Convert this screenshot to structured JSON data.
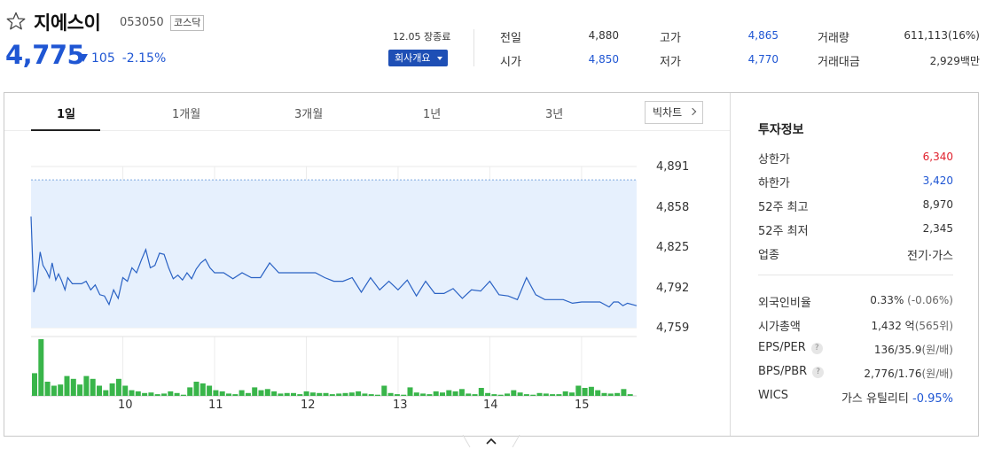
{
  "stock": {
    "name": "지에스이",
    "code": "053050",
    "market": "코스닥",
    "price": "4,775",
    "change": "105",
    "change_pct": "-2.15%",
    "close_time": "12.05 장종료",
    "company_btn": "회사개요"
  },
  "quote": {
    "prev_label": "전일",
    "prev_val": "4,880",
    "open_label": "시가",
    "open_val": "4,850",
    "high_label": "고가",
    "high_val": "4,865",
    "low_label": "저가",
    "low_val": "4,770",
    "volume_label": "거래량",
    "volume_val": "611,113(16%)",
    "amount_label": "거래대금",
    "amount_val": "2,929백만"
  },
  "tabs": [
    "1일",
    "1개월",
    "3개월",
    "1년",
    "3년"
  ],
  "active_tab": "1일",
  "big_chart_label": "빅차트",
  "colors": {
    "up": "#e0212d",
    "down": "#1f56d3",
    "line": "#2a62c4",
    "volume": "#39b54a",
    "area": "#e6f0fd"
  },
  "investment": {
    "title": "투자정보",
    "upper_limit_label": "상한가",
    "upper_limit": "6,340",
    "lower_limit_label": "하한가",
    "lower_limit": "3,420",
    "high52_label": "52주 최고",
    "high52": "8,970",
    "low52_label": "52주 최저",
    "low52": "2,345",
    "industry_label": "업종",
    "industry": "전기·가스",
    "foreign_label": "외국인비율",
    "foreign": "0.33%",
    "foreign_chg": "(-0.06%)",
    "mcap_label": "시가총액",
    "mcap": "1,432 억",
    "mcap_sub": "(565위)",
    "eps_label": "EPS/PER",
    "eps": "136/35.9",
    "eps_unit": "(원/배)",
    "bps_label": "BPS/PBR",
    "bps": "2,776/1.76",
    "bps_unit": "(원/배)",
    "wics_label": "WICS",
    "wics": "가스 유틸리티",
    "wics_chg": "-0.95%"
  },
  "chart_data": {
    "type": "line",
    "y_ticks": [
      4891,
      4858,
      4825,
      4792,
      4759
    ],
    "y_tick_labels": [
      "4,891",
      "4,858",
      "4,825",
      "4,792",
      "4,759"
    ],
    "ylim": [
      4759,
      4891
    ],
    "x_tick_labels": [
      "10",
      "11",
      "12",
      "13",
      "14",
      "15"
    ],
    "prev_close": 4880,
    "x_range": [
      9.0,
      15.6
    ],
    "series": [
      {
        "x": [
          9.0,
          9.03,
          9.06,
          9.1,
          9.13,
          9.17,
          9.2,
          9.23,
          9.27,
          9.3,
          9.33,
          9.37,
          9.4,
          9.45,
          9.5,
          9.55,
          9.6,
          9.65,
          9.7,
          9.75,
          9.8,
          9.85,
          9.9,
          9.95,
          10.0,
          10.05,
          10.1,
          10.15,
          10.2,
          10.25,
          10.3,
          10.35,
          10.4,
          10.45,
          10.5,
          10.55,
          10.6,
          10.65,
          10.7,
          10.75,
          10.8,
          10.85,
          10.9,
          10.95,
          11.0,
          11.1,
          11.2,
          11.3,
          11.4,
          11.5,
          11.6,
          11.7,
          11.8,
          11.9,
          12.0,
          12.1,
          12.2,
          12.3,
          12.4,
          12.5,
          12.6,
          12.7,
          12.8,
          12.9,
          13.0,
          13.1,
          13.2,
          13.3,
          13.4,
          13.5,
          13.6,
          13.7,
          13.8,
          13.9,
          14.0,
          14.1,
          14.2,
          14.3,
          14.4,
          14.5,
          14.6,
          14.7,
          14.8,
          14.9,
          15.0,
          15.1,
          15.2,
          15.3,
          15.35,
          15.4,
          15.45,
          15.5,
          15.6
        ],
        "y": [
          4850,
          4788,
          4795,
          4821,
          4810,
          4805,
          4800,
          4812,
          4798,
          4803,
          4798,
          4790,
          4800,
          4795,
          4795,
          4795,
          4797,
          4790,
          4794,
          4786,
          4785,
          4778,
          4790,
          4783,
          4800,
          4797,
          4808,
          4804,
          4814,
          4823,
          4808,
          4810,
          4820,
          4819,
          4808,
          4799,
          4802,
          4798,
          4804,
          4799,
          4807,
          4812,
          4815,
          4808,
          4804,
          4804,
          4799,
          4804,
          4800,
          4800,
          4812,
          4804,
          4804,
          4804,
          4804,
          4804,
          4800,
          4797,
          4797,
          4800,
          4788,
          4800,
          4790,
          4797,
          4790,
          4798,
          4785,
          4797,
          4787,
          4787,
          4791,
          4783,
          4790,
          4789,
          4797,
          4786,
          4785,
          4782,
          4800,
          4786,
          4782,
          4782,
          4782,
          4779,
          4780,
          4780,
          4780,
          4776,
          4780,
          4780,
          4777,
          4779,
          4777
        ],
        "volume": [
          40,
          100,
          25,
          18,
          20,
          35,
          30,
          20,
          35,
          30,
          18,
          10,
          22,
          30,
          18,
          10,
          8,
          5,
          6,
          3,
          4,
          8,
          5,
          2,
          15,
          25,
          22,
          18,
          10,
          8,
          4,
          3,
          10,
          5,
          15,
          10,
          12,
          8,
          4,
          5,
          5,
          3,
          8,
          6,
          5,
          5,
          3,
          4,
          5,
          6,
          8,
          4,
          3,
          2,
          18,
          5,
          3,
          2,
          15,
          6,
          4,
          3,
          8,
          6,
          10,
          8,
          12,
          4,
          3,
          14,
          5,
          3,
          2,
          4,
          10,
          6,
          3,
          2,
          5,
          4,
          3,
          3,
          8,
          6,
          18,
          14,
          16,
          10,
          5,
          4,
          5,
          12,
          3
        ]
      }
    ],
    "grid": true
  }
}
